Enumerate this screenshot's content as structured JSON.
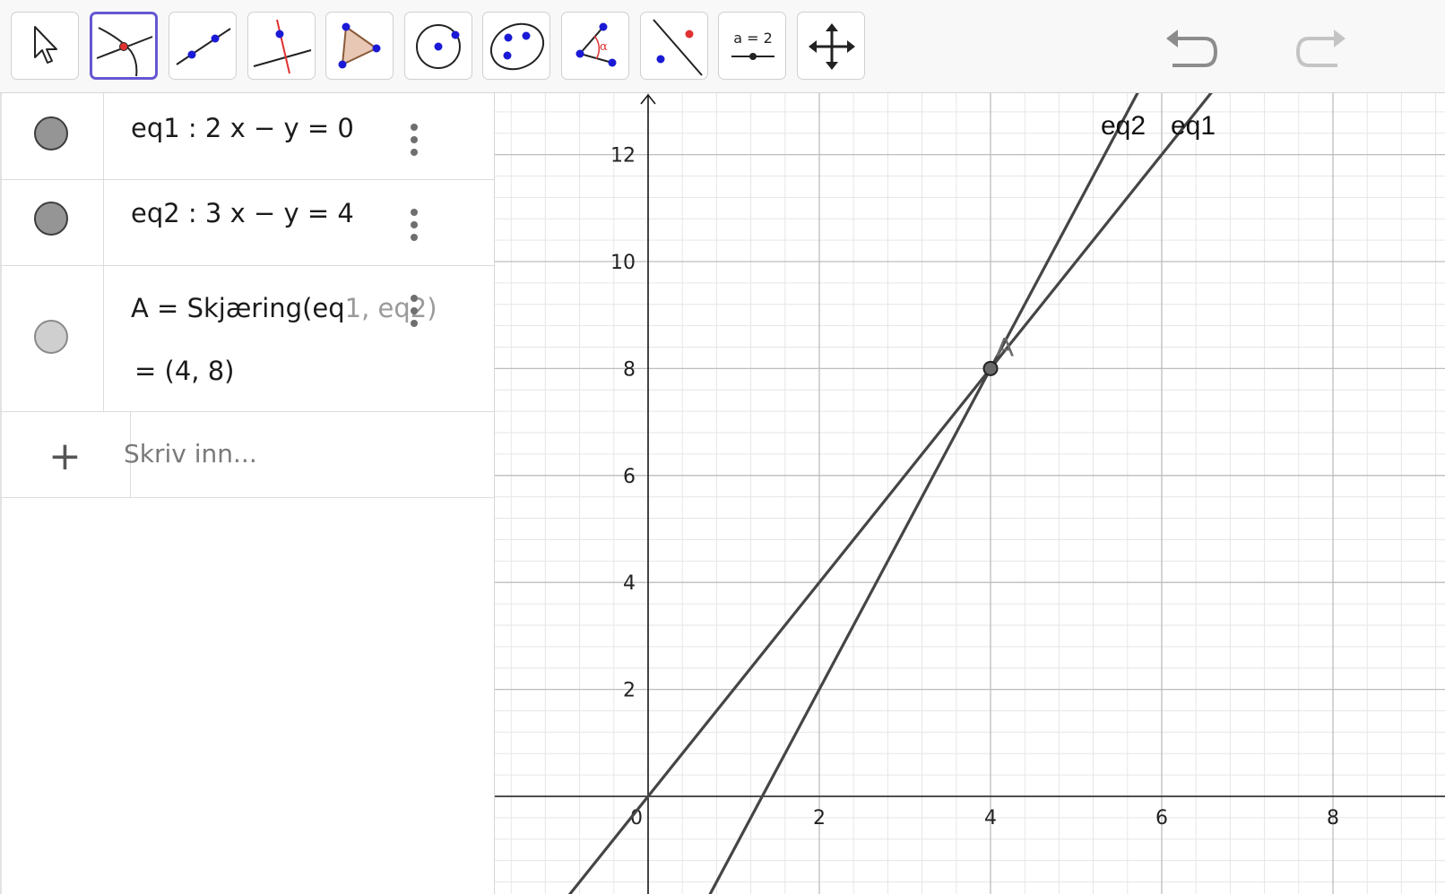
{
  "toolbar": {
    "tools": [
      {
        "name": "move-tool",
        "selected": false
      },
      {
        "name": "intersect-tool",
        "selected": true
      },
      {
        "name": "line-tool",
        "selected": false
      },
      {
        "name": "perpendicular-line-tool",
        "selected": false
      },
      {
        "name": "polygon-tool",
        "selected": false
      },
      {
        "name": "circle-center-point-tool",
        "selected": false
      },
      {
        "name": "conic-five-points-tool",
        "selected": false
      },
      {
        "name": "angle-tool",
        "selected": false
      },
      {
        "name": "reflect-tool",
        "selected": false
      },
      {
        "name": "slider-tool",
        "selected": false
      },
      {
        "name": "move-graphics-view-tool",
        "selected": false
      }
    ],
    "slider_label": "a = 2",
    "angle_symbol": "α"
  },
  "algebra": {
    "rows": [
      {
        "name": "eq1",
        "text": "eq1 : 2 x − y = 0",
        "visible": true
      },
      {
        "name": "eq2",
        "text": "eq2 : 3 x − y = 4",
        "visible": true
      },
      {
        "name": "A",
        "text_main": "A = Skjæring(eq",
        "arg1_rest": "1, eq",
        "arg2_rest": "2)",
        "value": "= (4, 8)",
        "visible": false
      }
    ],
    "input_placeholder": "Skriv inn..."
  },
  "graphics": {
    "x_ticks": [
      "0",
      "2",
      "4",
      "6",
      "8"
    ],
    "y_ticks": [
      "2",
      "4",
      "6",
      "8",
      "10",
      "12"
    ],
    "line_labels": [
      "eq2",
      "eq1"
    ],
    "point_label": "A",
    "colors": {
      "line": "#454545",
      "grid_major": "#bdbdbd",
      "grid_minor": "#e6e6e6",
      "axis": "#1a1a1a",
      "select": "#6557d2"
    }
  }
}
